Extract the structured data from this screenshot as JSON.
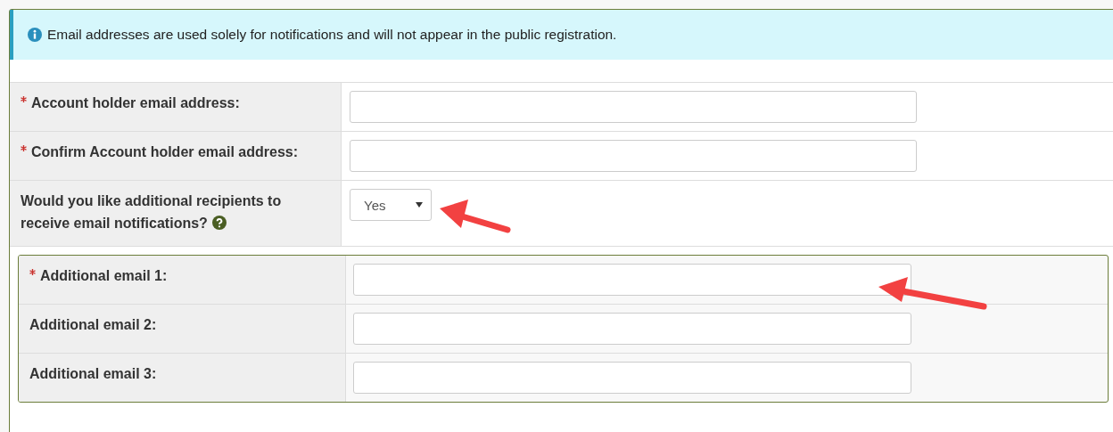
{
  "alert": {
    "text": "Email addresses are used solely for notifications and will not appear in the public registration."
  },
  "fields": [
    {
      "kind": "input",
      "label": "Account holder email address:",
      "required": true,
      "help": false
    },
    {
      "kind": "input",
      "label": "Confirm Account holder email address:",
      "required": true,
      "help": false
    },
    {
      "kind": "select",
      "label": "Would you like additional recipients to receive email notifications?",
      "required": false,
      "help": true,
      "value": "Yes"
    }
  ],
  "additional_fields": [
    {
      "kind": "input",
      "label": "Additional email 1:",
      "required": true,
      "help": false
    },
    {
      "kind": "input",
      "label": "Additional email 2:",
      "required": false,
      "help": false
    },
    {
      "kind": "input",
      "label": "Additional email 3:",
      "required": false,
      "help": false
    }
  ]
}
